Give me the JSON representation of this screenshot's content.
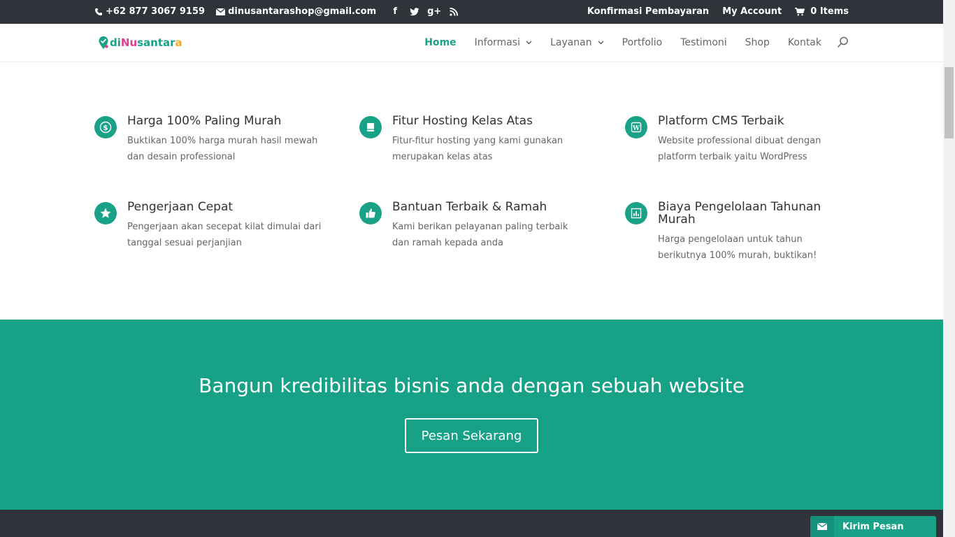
{
  "topbar": {
    "phone": "+62 877 3067 9159",
    "email": "dinusantarashop@gmail.com",
    "social": [
      "facebook-icon",
      "twitter-icon",
      "google-plus-icon",
      "rss-icon"
    ],
    "google_plus_glyph": "g+",
    "links": {
      "confirm": "Konfirmasi Pembayaran",
      "account": "My Account",
      "cart": "0 Items"
    }
  },
  "header": {
    "logo": {
      "part1": "di",
      "part2": "Nu",
      "part3": "santar",
      "part4": "a"
    },
    "nav": [
      {
        "label": "Home",
        "active": true
      },
      {
        "label": "Informasi",
        "dropdown": true
      },
      {
        "label": "Layanan",
        "dropdown": true
      },
      {
        "label": "Portfolio"
      },
      {
        "label": "Testimoni"
      },
      {
        "label": "Shop"
      },
      {
        "label": "Kontak"
      }
    ]
  },
  "features": [
    {
      "icon": "dollar-icon",
      "title": "Harga 100% Paling Murah",
      "text": "Buktikan 100% harga murah hasil mewah dan desain professional"
    },
    {
      "icon": "hard-drive-icon",
      "title": "Fitur Hosting Kelas Atas",
      "text": "Fitur-fitur hosting yang kami gunakan merupakan kelas atas"
    },
    {
      "icon": "wordpress-icon",
      "title": "Platform CMS Terbaik",
      "text": "Website professional dibuat dengan platform terbaik yaitu WordPress"
    },
    {
      "icon": "star-icon",
      "title": "Pengerjaan Cepat",
      "text": "Pengerjaan akan secepat kilat dimulai dari tanggal sesuai perjanjian"
    },
    {
      "icon": "thumbs-up-icon",
      "title": "Bantuan Terbaik & Ramah",
      "text": "Kami berikan pelayanan paling terbaik dan ramah kepada anda"
    },
    {
      "icon": "chart-icon",
      "title": "Biaya Pengelolaan Tahunan Murah",
      "text": "Harga pengelolaan untuk tahun berikutnya 100% murah, buktikan!"
    }
  ],
  "cta": {
    "heading": "Bangun kredibilitas bisnis anda dengan sebuah website",
    "button": "Pesan Sekarang"
  },
  "chat": {
    "label": "Kirim Pesan"
  },
  "colors": {
    "accent": "#17a186",
    "dark": "#2e3439"
  }
}
